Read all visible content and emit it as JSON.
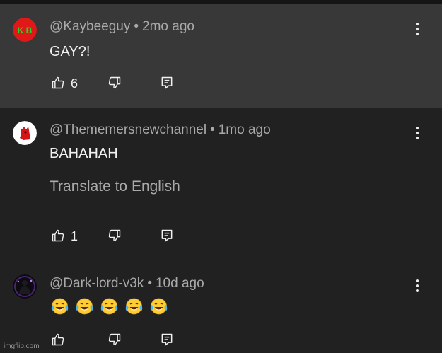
{
  "comments": [
    {
      "author": "@Kaybeeguy",
      "separator": "•",
      "time": "2mo ago",
      "text": "GAY?!",
      "likes": "6",
      "avatar_text": "K B",
      "avatar_bg": "#e01818",
      "avatar_fg": "#27d42a",
      "highlighted": true
    },
    {
      "author": "@Thememersnewchannel",
      "separator": "•",
      "time": "1mo ago",
      "text": "BAHAHAH",
      "translate": "Translate to English",
      "likes": "1",
      "avatar_bg": "#ffffff",
      "avatar_fg": "#d41515"
    },
    {
      "author": "@Dark-lord-v3k",
      "separator": "•",
      "time": "10d ago",
      "emoji": [
        "😂",
        "😂",
        "😂",
        "😂",
        "😂"
      ],
      "likes": ""
    }
  ],
  "watermark": "imgflip.com",
  "icons": {
    "like": "thumb-up-icon",
    "dislike": "thumb-down-icon",
    "reply": "reply-icon",
    "more": "more-vertical-icon"
  },
  "colors": {
    "background": "#212121",
    "highlight": "#383838",
    "secondary_text": "#aaaaaa",
    "primary_text": "#f1f1f1"
  }
}
